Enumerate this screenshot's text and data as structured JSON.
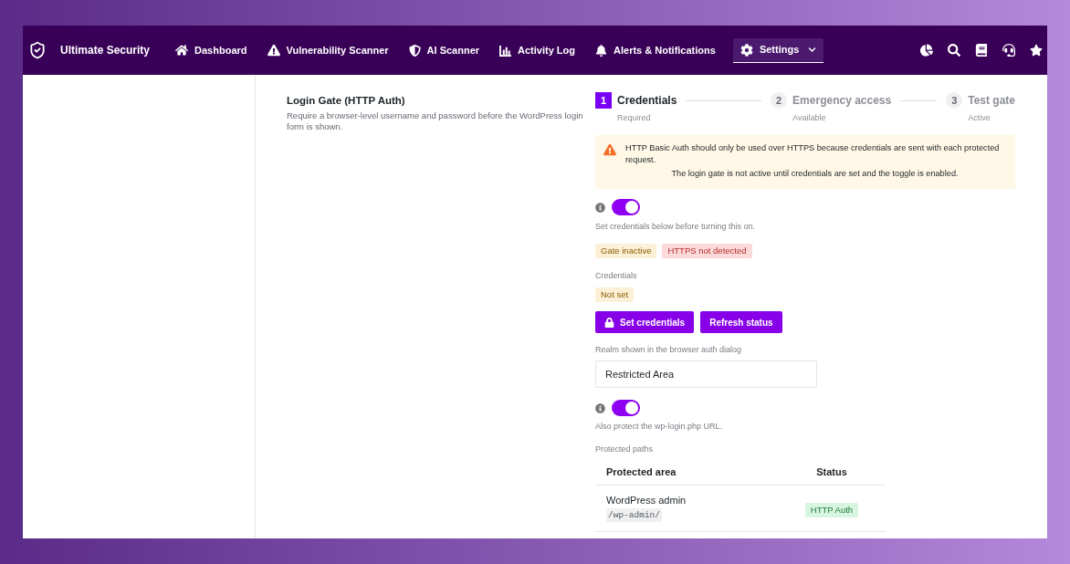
{
  "nav": {
    "brand": "Ultimate Security",
    "items": [
      {
        "label": "Dashboard",
        "selected": false,
        "dropdown": false
      },
      {
        "label": "Vulnerability Scanner",
        "selected": false,
        "dropdown": false
      },
      {
        "label": "AI Scanner",
        "selected": false,
        "dropdown": false
      },
      {
        "label": "Activity Log",
        "selected": false,
        "dropdown": false
      },
      {
        "label": "Alerts & Notifications",
        "selected": false,
        "dropdown": false
      },
      {
        "label": "Settings",
        "selected": true,
        "dropdown": true
      }
    ]
  },
  "section": {
    "title": "Login Gate (HTTP Auth)",
    "description": "Require a browser-level username and password before the WordPress login form is shown."
  },
  "steps": [
    {
      "number": "1",
      "label": "Credentials",
      "status": "Required",
      "selected": true
    },
    {
      "number": "2",
      "label": "Emergency access",
      "status": "Available",
      "selected": false
    },
    {
      "number": "3",
      "label": "Test gate",
      "status": "Active",
      "selected": false
    }
  ],
  "notice": {
    "kind": "warning",
    "message": "HTTP Basic Auth should only be used over HTTPS because credentials are sent with each protected request.",
    "note": "The login gate is not active until credentials are set and the toggle is enabled."
  },
  "gate_toggle": {
    "on": true,
    "help": "Set credentials below before turning this on."
  },
  "status_badges": [
    {
      "label": "Gate inactive",
      "kind": "warning"
    },
    {
      "label": "HTTPS not detected",
      "kind": "error"
    }
  ],
  "credentials": {
    "label": "Credentials",
    "badge": {
      "label": "Not set",
      "kind": "warning"
    }
  },
  "buttons": [
    {
      "label": "Set credentials"
    },
    {
      "label": "Refresh status"
    }
  ],
  "realm": {
    "label": "Realm shown in the browser auth dialog",
    "value": "Restricted Area"
  },
  "login_url_toggle": {
    "on": true,
    "help": "Also protect the wp-login.php URL."
  },
  "protected_paths": {
    "label": "Protected paths",
    "columns": [
      "Protected area",
      "Status"
    ],
    "rows": [
      {
        "area": "WordPress admin",
        "path": "/wp-admin/",
        "status": {
          "label": "HTTP Auth",
          "kind": "success"
        }
      }
    ]
  }
}
